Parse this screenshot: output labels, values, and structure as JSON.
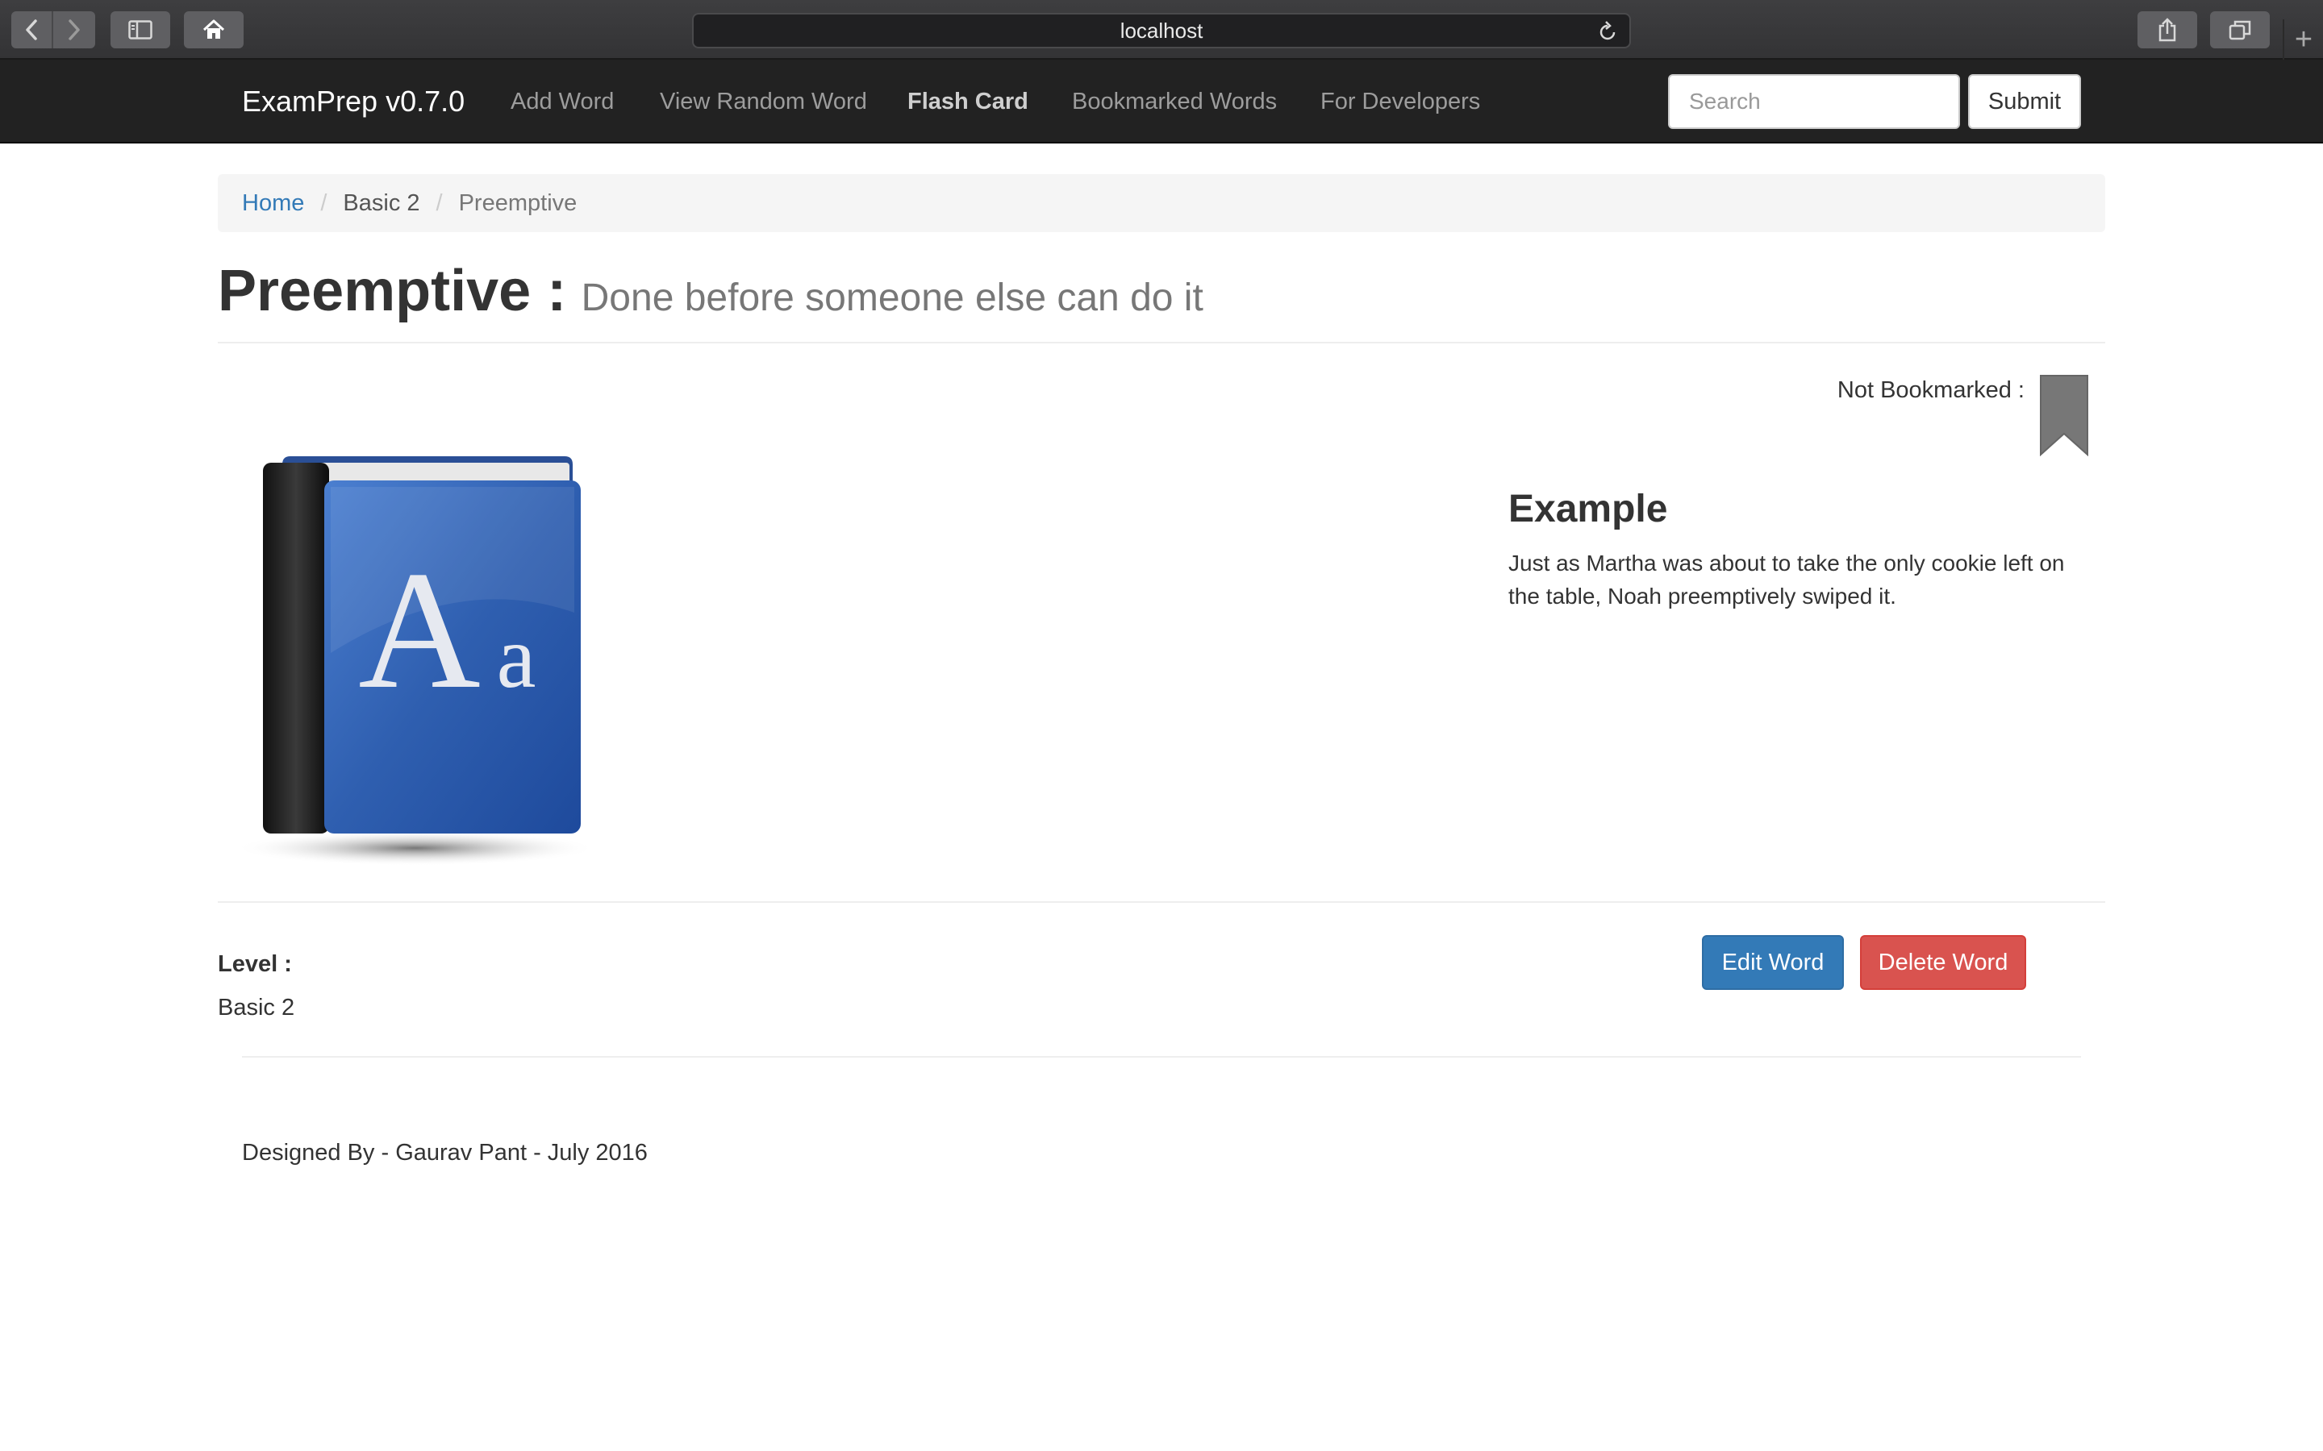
{
  "browser": {
    "url": "localhost",
    "icons": [
      "back-icon",
      "forward-icon",
      "sidebar-icon",
      "home-icon",
      "reload-icon",
      "share-icon",
      "tabs-icon",
      "plus-icon"
    ]
  },
  "navbar": {
    "brand": "ExamPrep v0.7.0",
    "links": [
      "Add Word",
      "View Random Word",
      "Flash Card",
      "Bookmarked Words",
      "For Developers"
    ],
    "active_link": "Flash Card",
    "search_placeholder": "Search",
    "submit_label": "Submit"
  },
  "breadcrumb": {
    "home": "Home",
    "level": "Basic 2",
    "current": "Preemptive",
    "separator": "/"
  },
  "word": {
    "title": "Preemptive :",
    "meaning": "Done before someone else can do it"
  },
  "bookmark": {
    "label": "Not Bookmarked :",
    "icon": "bookmark-icon"
  },
  "image": {
    "icon": "dictionary-book-icon",
    "glyph_large": "A",
    "glyph_small": "a"
  },
  "example": {
    "heading": "Example",
    "text": "Just as Martha was about to take the only cookie left on the table, Noah preemptively swiped it."
  },
  "level": {
    "label": "Level :",
    "value": "Basic 2"
  },
  "actions": {
    "edit_label": "Edit Word",
    "delete_label": "Delete Word"
  },
  "footer": {
    "text": "Designed By - Gaurav Pant - July 2016"
  },
  "colors": {
    "navbar_bg": "#222222",
    "link_primary": "#337ab7",
    "btn_primary": "#337ab7",
    "btn_danger": "#d9534f",
    "bookmark_gray": "#777777",
    "book_blue": "#2f5fb0"
  }
}
